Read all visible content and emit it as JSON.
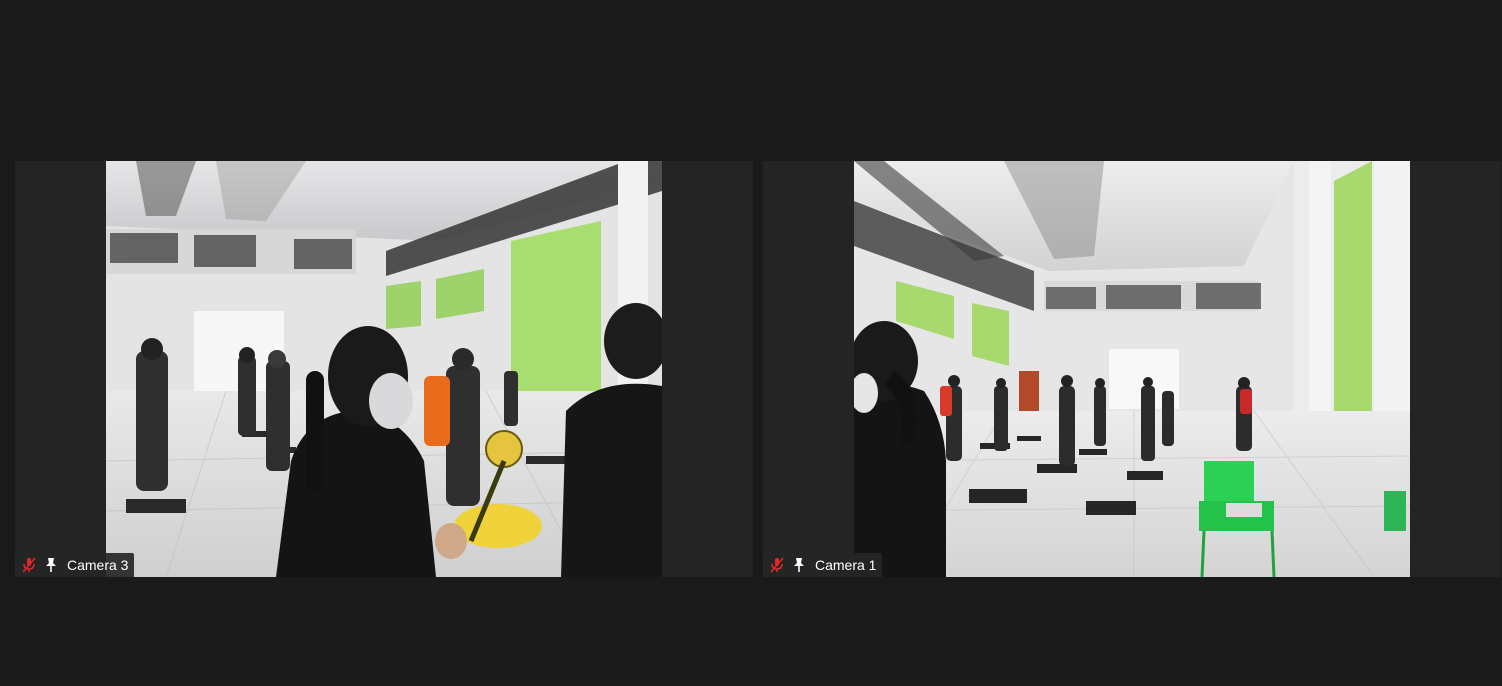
{
  "participants": [
    {
      "name": "Camera 3",
      "muted": true,
      "pinned": true,
      "mic_icon": "mic-muted-icon",
      "pin_icon": "pin-icon"
    },
    {
      "name": "Camera 1",
      "muted": true,
      "pinned": true,
      "mic_icon": "mic-muted-icon",
      "pin_icon": "pin-icon"
    }
  ],
  "colors": {
    "background": "#1a1a1a",
    "tile_background": "#242424",
    "muted_icon": "#e02828",
    "label_text": "#ffffff"
  }
}
